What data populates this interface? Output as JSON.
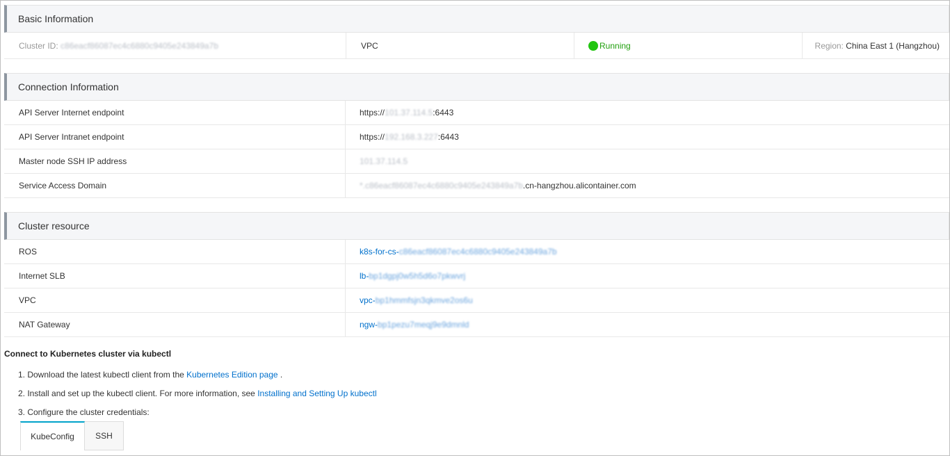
{
  "basic": {
    "title": "Basic Information",
    "cluster_id_label": "Cluster ID:",
    "cluster_id_value": "c86eacf86087ec4c6880c9405e243849a7b",
    "network": "VPC",
    "status": "Running",
    "region_label": "Region:",
    "region_value": "China East 1 (Hangzhou)"
  },
  "connection": {
    "title": "Connection Information",
    "rows": [
      {
        "label": "API Server Internet endpoint",
        "prefix": "https://",
        "blurred": "101.37.114.5",
        "suffix": ":6443"
      },
      {
        "label": "API Server Intranet endpoint",
        "prefix": "https://",
        "blurred": "192.168.3.227",
        "suffix": ":6443"
      },
      {
        "label": "Master node SSH IP address",
        "prefix": "",
        "blurred": "101.37.114.5",
        "suffix": ""
      },
      {
        "label": "Service Access Domain",
        "prefix": "",
        "blurred": "*.c86eacf86087ec4c6880c9405e243849a7b",
        "suffix": ".cn-hangzhou.alicontainer.com"
      }
    ]
  },
  "resource": {
    "title": "Cluster resource",
    "rows": [
      {
        "label": "ROS",
        "prefix": "k8s-for-cs-",
        "blurred": "c86eacf86087ec4c6880c9405e243849a7b"
      },
      {
        "label": "Internet SLB",
        "prefix": "lb-",
        "blurred": "bp1dgpj0w5h5d6o7pkwvrj"
      },
      {
        "label": "VPC",
        "prefix": "vpc-",
        "blurred": "bp1hmmfsjn3qkmve2os6u"
      },
      {
        "label": "NAT Gateway",
        "prefix": "ngw-",
        "blurred": "bp1pezu7meqj9e9dmnld"
      }
    ]
  },
  "kubectl": {
    "heading": "Connect to Kubernetes cluster via kubectl",
    "step1_text": "1. Download the latest kubectl client from the ",
    "step1_link": "Kubernetes Edition page",
    "step1_end": " .",
    "step2_text": "2. Install and set up the kubectl client. For more information, see ",
    "step2_link": "Installing and Setting Up kubectl",
    "step3_text": "3. Configure the cluster credentials:",
    "tabs": [
      "KubeConfig",
      "SSH"
    ]
  },
  "colors": {
    "accent": "#00a2ca",
    "link": "#0070cc",
    "running": "#22c511"
  }
}
